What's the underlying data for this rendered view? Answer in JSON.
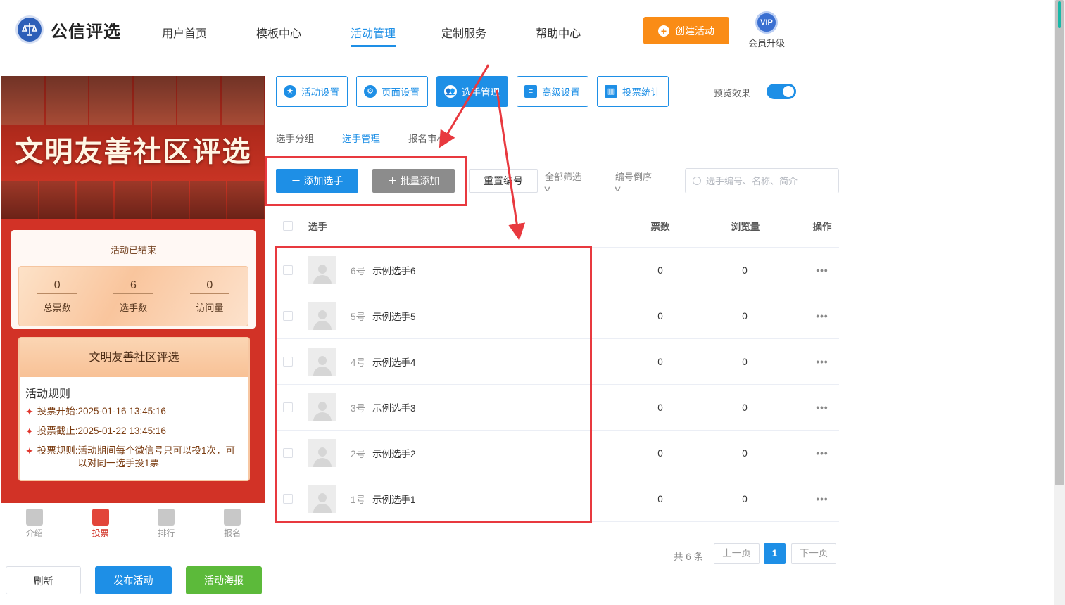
{
  "brand": {
    "name": "公信评选"
  },
  "nav": {
    "items": [
      {
        "label": "用户首页"
      },
      {
        "label": "模板中心"
      },
      {
        "label": "活动管理"
      },
      {
        "label": "定制服务"
      },
      {
        "label": "帮助中心"
      }
    ],
    "active": "活动管理"
  },
  "header": {
    "create_label": "创建活动",
    "vip_badge": "VIP",
    "vip_label": "会员升级"
  },
  "preview": {
    "banner_title": "文明友善社区评选",
    "status": "活动已结束",
    "stats": [
      {
        "value": "0",
        "label": "总票数"
      },
      {
        "value": "6",
        "label": "选手数"
      },
      {
        "value": "0",
        "label": "访问量"
      }
    ],
    "rules_card_title": "文明友善社区评选",
    "rules_heading": "活动规则",
    "rules": [
      {
        "label": "投票开始:",
        "value": "2025-01-16 13:45:16"
      },
      {
        "label": "投票截止:",
        "value": "2025-01-22 13:45:16"
      },
      {
        "label": "投票规则:",
        "value": "活动期间每个微信号只可以投1次，可以对同一选手投1票"
      }
    ],
    "tabbar": [
      {
        "label": "介绍"
      },
      {
        "label": "投票"
      },
      {
        "label": "排行"
      },
      {
        "label": "报名"
      }
    ],
    "active_tab": "投票",
    "buttons": {
      "refresh": "刷新",
      "publish": "发布活动",
      "poster": "活动海报"
    }
  },
  "toolbar": {
    "buttons": [
      {
        "label": "活动设置",
        "icon": "star-icon"
      },
      {
        "label": "页面设置",
        "icon": "gear-icon"
      },
      {
        "label": "选手管理",
        "icon": "users-icon"
      },
      {
        "label": "高级设置",
        "icon": "settings-list-icon"
      },
      {
        "label": "投票统计",
        "icon": "bar-chart-icon"
      }
    ],
    "active": "选手管理",
    "preview_label": "预览效果",
    "preview_on": true
  },
  "subtabs": {
    "items": [
      {
        "label": "选手分组"
      },
      {
        "label": "选手管理"
      },
      {
        "label": "报名审核"
      }
    ],
    "active": "选手管理"
  },
  "actions": {
    "add": "添加选手",
    "batch_add": "批量添加",
    "renumber": "重置编号",
    "filter_all": "全部筛选",
    "sort_order": "编号倒序",
    "search_placeholder": "选手编号、名称、简介"
  },
  "table": {
    "columns": {
      "player": "选手",
      "votes": "票数",
      "views": "浏览量",
      "ops": "操作"
    },
    "rows": [
      {
        "num": "6号",
        "name": "示例选手6",
        "votes": "0",
        "views": "0"
      },
      {
        "num": "5号",
        "name": "示例选手5",
        "votes": "0",
        "views": "0"
      },
      {
        "num": "4号",
        "name": "示例选手4",
        "votes": "0",
        "views": "0"
      },
      {
        "num": "3号",
        "name": "示例选手3",
        "votes": "0",
        "views": "0"
      },
      {
        "num": "2号",
        "name": "示例选手2",
        "votes": "0",
        "views": "0"
      },
      {
        "num": "1号",
        "name": "示例选手1",
        "votes": "0",
        "views": "0"
      }
    ]
  },
  "pagination": {
    "total": "共 6 条",
    "prev": "上一页",
    "current": "1",
    "next": "下一页"
  },
  "colors": {
    "primary": "#1e8fe6",
    "create": "#fa8c16",
    "annotation": "#e8393f",
    "poster": "#5cba3a"
  }
}
